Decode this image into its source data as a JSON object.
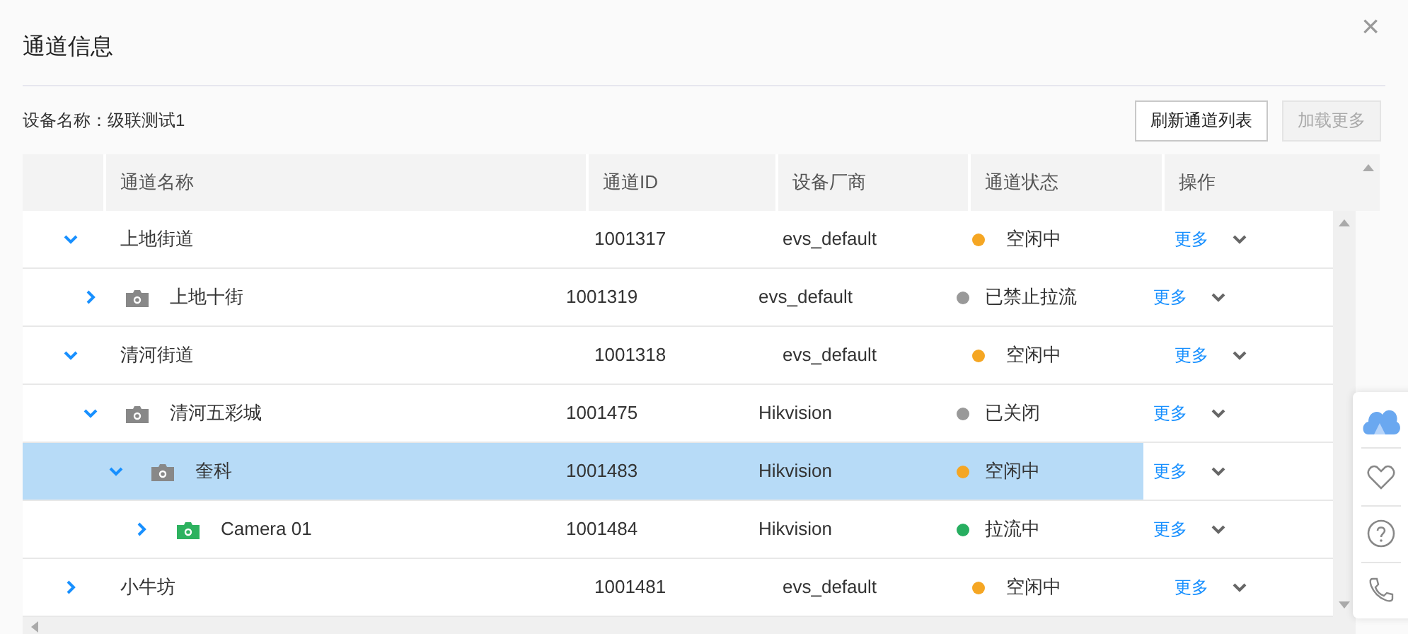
{
  "dialog": {
    "title": "通道信息",
    "close": "×"
  },
  "device_label": "设备名称：级联测试1",
  "buttons": [
    {
      "label": "刷新通道列表",
      "disabled": false
    },
    {
      "label": "加载更多",
      "disabled": true
    }
  ],
  "table": {
    "columns": [
      "通道名称",
      "通道ID",
      "设备厂商",
      "通道状态",
      "操作"
    ],
    "rows": [
      {
        "name": "上地街道",
        "kind": "group",
        "expanded": true,
        "selected": false,
        "id": "1001317",
        "vendor": "evs_default",
        "status": {
          "text": "空闲中",
          "color": "#f5a623"
        },
        "action": "更多",
        "children": [
          {
            "name": "上地十街",
            "kind": "camera",
            "camera": {
              "color": "#888888"
            },
            "expanded": false,
            "selected": false,
            "id": "1001319",
            "vendor": "evs_default",
            "status": {
              "text": "已禁止拉流",
              "color": "#999999"
            },
            "action": "更多"
          }
        ]
      },
      {
        "name": "清河街道",
        "kind": "group",
        "expanded": true,
        "selected": false,
        "id": "1001318",
        "vendor": "evs_default",
        "status": {
          "text": "空闲中",
          "color": "#f5a623"
        },
        "action": "更多",
        "children": [
          {
            "name": "清河五彩城",
            "kind": "camera",
            "camera": {
              "color": "#888888"
            },
            "expanded": true,
            "selected": false,
            "id": "1001475",
            "vendor": "Hikvision",
            "status": {
              "text": "已关闭",
              "color": "#999999"
            },
            "action": "更多",
            "children": [
              {
                "name": "奎科",
                "kind": "camera",
                "camera": {
                  "color": "#888888"
                },
                "expanded": true,
                "selected": true,
                "id": "1001483",
                "vendor": "Hikvision",
                "status": {
                  "text": "空闲中",
                  "color": "#f5a623"
                },
                "action": "更多",
                "children": [
                  {
                    "name": "Camera 01",
                    "kind": "camera",
                    "camera": {
                      "color": "#2db25f"
                    },
                    "expanded": false,
                    "selected": false,
                    "id": "1001484",
                    "vendor": "Hikvision",
                    "status": {
                      "text": "拉流中",
                      "color": "#27ae60"
                    },
                    "action": "更多"
                  }
                ]
              }
            ]
          }
        ]
      },
      {
        "name": "小牛坊",
        "kind": "group",
        "expanded": false,
        "selected": false,
        "id": "1001481",
        "vendor": "evs_default",
        "status": {
          "text": "空闲中",
          "color": "#f5a623"
        },
        "action": "更多"
      }
    ]
  }
}
